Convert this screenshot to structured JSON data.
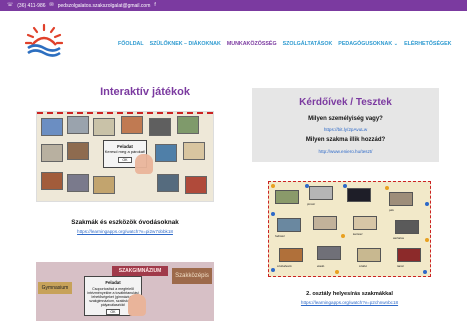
{
  "topbar": {
    "phone": "(36) 411-986",
    "email": "pedszolgalatos.szakszolgalat@gmail.com",
    "facebook_icon": "f"
  },
  "nav": {
    "items": [
      {
        "label": "FŐOLDAL",
        "color": "#2d9ad0"
      },
      {
        "label": "SZÜLŐKNEK – DIÁKOKNAK",
        "color": "#2d9ad0"
      },
      {
        "label": "MUNKAKÖZÖSSÉG",
        "color": "#7b3aa0"
      },
      {
        "label": "SZOLGÁLTATÁSOK",
        "color": "#2d9ad0"
      },
      {
        "label": "PEDAGÓGUSOKNAK ⌄",
        "color": "#2d9ad0"
      },
      {
        "label": "ELÉRHETŐSÉGEK",
        "color": "#2d9ad0"
      }
    ]
  },
  "left": {
    "title": "Interaktív játékok",
    "game1": {
      "panel_title": "Feladat",
      "panel_text": "Keresd meg a párokat!",
      "ok": "OK",
      "caption": "Szakmák és eszközök óvodásoknak",
      "link": "https://learningapps.org/watch?v=pi2w7obbk18"
    },
    "game3": {
      "panel_title": "Feladat",
      "panel_text": "Csoportosítsd a megfelelő intézményekbe a továbbtanulási lehetőségeket (gimnázium, szakgimnázium, szakiskola) a pályaválasztók!",
      "ok": "OK",
      "sign1": "SZAKGIMNÁZIUM",
      "sign2": "Szakközépis",
      "sign3": "Gymnasium"
    }
  },
  "right": {
    "title": "Kérdőívek / Tesztek",
    "q1": "Milyen személyiség vagy?",
    "l1": "https://bit.ly/2pAvuLw",
    "q2": "Milyen szakma illik hozzád?",
    "l2": "http://www.eniero.hu/teszt/",
    "game2": {
      "caption": "2. osztály helyesírás szakmákkal",
      "link": "https://learningapps.org/watch?v=p2chnwnbc18",
      "labels": [
        "pincér",
        "pék",
        "fodrász",
        "kertész",
        "asztalos",
        "szobafestő",
        "eladó",
        "szabó",
        "tanár"
      ]
    }
  },
  "colors": {
    "brand_purple": "#7b3aa0",
    "brand_blue": "#2d9ad0",
    "link_blue": "#2d69c8"
  }
}
